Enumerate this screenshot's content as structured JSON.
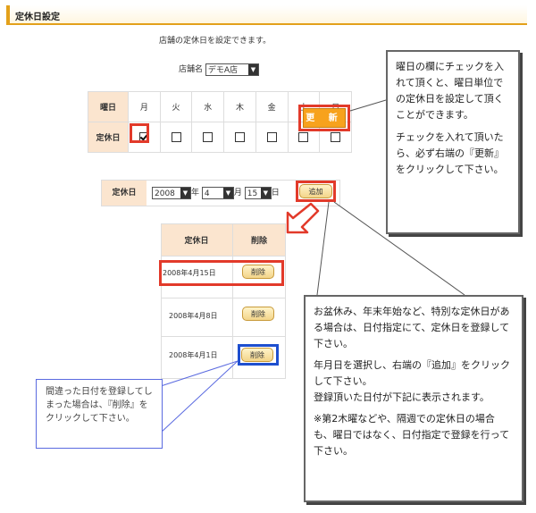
{
  "header": {
    "title": "定休日設定"
  },
  "intro": "店舗の定休日を設定できます。",
  "store": {
    "label": "店舗名",
    "selected": "デモA店"
  },
  "weekday": {
    "row_header": "曜日",
    "row2_header": "定休日",
    "days": [
      "月",
      "火",
      "水",
      "木",
      "金",
      "土",
      "日"
    ],
    "checked": [
      true,
      false,
      false,
      false,
      false,
      false,
      false
    ],
    "update_label": "更 新"
  },
  "date_add": {
    "label": "定休日",
    "year": "2008",
    "year_unit": "年",
    "month": "4",
    "month_unit": "月",
    "day": "15",
    "day_unit": "日",
    "add_label": "追加"
  },
  "holiday_table": {
    "headers": [
      "定休日",
      "削除"
    ],
    "rows": [
      {
        "date": "2008年4月15日",
        "action": "削除"
      },
      {
        "date": "2008年4月8日",
        "action": "削除"
      },
      {
        "date": "2008年4月1日",
        "action": "削除"
      }
    ]
  },
  "callout_top": {
    "p1": "曜日の欄にチェックを入れて頂くと、曜日単位での定休日を設定して頂くことができます。",
    "p2": "チェックを入れて頂いたら、必ず右端の『更新』をクリックして下さい。"
  },
  "callout_bottom": {
    "p1": "お盆休み、年末年始など、特別な定休日がある場合は、日付指定にて、定休日を登録して下さい。",
    "p2": "年月日を選択し、右端の『追加』をクリックして下さい。",
    "p3": "登録頂いた日付が下記に表示されます。",
    "p4": "※第2木曜などや、隔週での定休日の場合も、曜日ではなく、日付指定で登録を行って下さい。"
  },
  "callout_blue": {
    "text": "間違った日付を登録してしまった場合は、『削除』をクリックして下さい。"
  },
  "colors": {
    "accent": "#e3a11b",
    "button": "#f7a21d",
    "highlight_red": "#e23a2a",
    "highlight_blue": "#1e4fcf"
  }
}
